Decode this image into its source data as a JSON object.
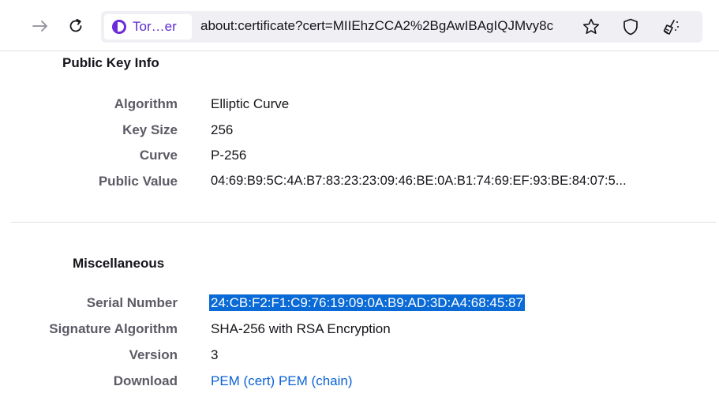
{
  "toolbar": {
    "forward_icon": "arrow-right-icon",
    "reload_icon": "reload-icon",
    "identity_label": "Tor…er",
    "url": "about:certificate?cert=MIIEhzCCA2%2BgAwIBAgIQJMvy8c",
    "bookmark_icon": "star-icon",
    "shield_icon": "shield-icon",
    "broom_icon": "broom-icon",
    "brand_color": "#6b2bd9"
  },
  "public_key_info": {
    "title": "Public Key Info",
    "rows": [
      {
        "label": "Algorithm",
        "value": "Elliptic Curve"
      },
      {
        "label": "Key Size",
        "value": "256"
      },
      {
        "label": "Curve",
        "value": "P-256"
      },
      {
        "label": "Public Value",
        "value": "04:69:B9:5C:4A:B7:83:23:23:09:46:BE:0A:B1:74:69:EF:93:BE:84:07:5..."
      }
    ]
  },
  "miscellaneous": {
    "title": "Miscellaneous",
    "serial_label": "Serial Number",
    "serial_value": "24:CB:F2:F1:C9:76:19:09:0A:B9:AD:3D:A4:68:45:87",
    "sigalg_label": "Signature Algorithm",
    "sigalg_value": "SHA-256 with RSA Encryption",
    "version_label": "Version",
    "version_value": "3",
    "download_label": "Download",
    "download_links": [
      "PEM (cert)",
      "PEM (chain)"
    ]
  },
  "colors": {
    "selection": "#0a6ad6",
    "link": "#0b62d6",
    "label": "#5b5b66"
  }
}
